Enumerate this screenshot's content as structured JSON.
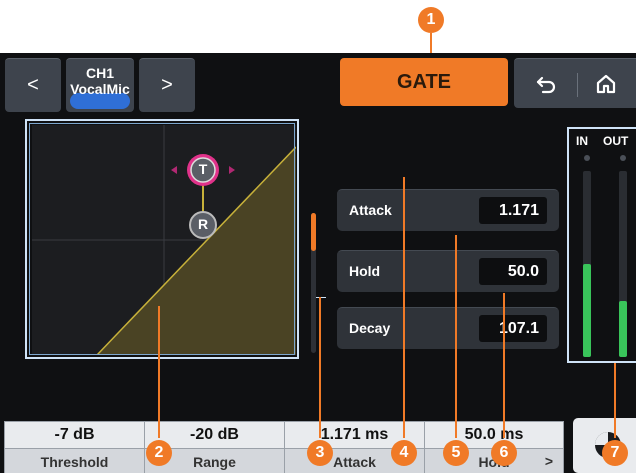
{
  "header": {
    "prev_label": "<",
    "next_label": ">",
    "channel_line1": "CH1",
    "channel_line2": "VocalMic",
    "mode_label": "GATE",
    "back_icon": "undo-arrow-icon",
    "home_icon": "home-icon"
  },
  "graph": {
    "threshold_handle_label": "T",
    "range_handle_label": "R",
    "colors": {
      "curve": "#c7b13a",
      "fill": "#4a4324",
      "threshold_ring": "#e0328a"
    }
  },
  "params": [
    {
      "label": "Attack",
      "value": "1.171"
    },
    {
      "label": "Hold",
      "value": "50.0"
    },
    {
      "label": "Decay",
      "value": "107.1"
    }
  ],
  "meter": {
    "in_label": "IN",
    "out_label": "OUT",
    "in_level": 0.5,
    "out_level": 0.3
  },
  "bottom_bar": [
    {
      "value": "-7 dB",
      "name": "Threshold"
    },
    {
      "value": "-20 dB",
      "name": "Range"
    },
    {
      "value": "1.171 ms",
      "name": "Attack"
    },
    {
      "value": "50.0 ms",
      "name": "Hold"
    }
  ],
  "bottom_more_label": ">",
  "callouts": [
    "1",
    "2",
    "3",
    "4",
    "5",
    "6",
    "7"
  ],
  "accent_color": "#f07a27"
}
